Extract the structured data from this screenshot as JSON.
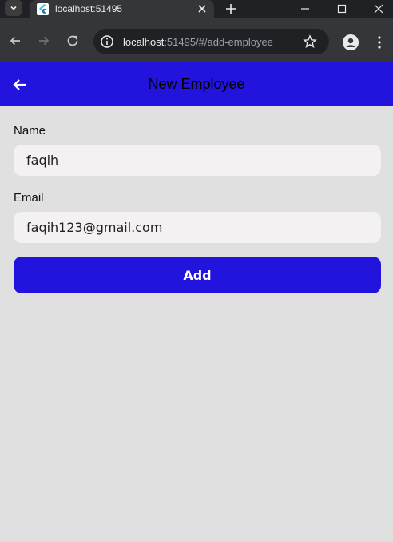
{
  "browser": {
    "tab_title": "localhost:51495",
    "url_host": "localhost",
    "url_rest": ":51495/#/add-employee"
  },
  "icons": {
    "tab_search": "chevron-down-icon",
    "favicon": "flutter-icon",
    "tab_close": "close-icon",
    "new_tab": "plus-icon",
    "minimize": "minimize-icon",
    "maximize": "maximize-icon",
    "window_close": "close-icon",
    "back": "arrow-left-icon",
    "forward": "arrow-right-icon",
    "reload": "reload-icon",
    "site_info": "info-icon",
    "bookmark": "star-icon",
    "profile": "person-icon",
    "menu": "more-vertical-icon",
    "appbar_back": "arrow-left-icon"
  },
  "app": {
    "title": "New Employee",
    "form": {
      "name_label": "Name",
      "name_value": "faqih",
      "email_label": "Email",
      "email_value": "faqih123@gmail.com",
      "add_label": "Add"
    }
  },
  "colors": {
    "primary": "#2214dc",
    "background": "#e0e0e0",
    "input_fill": "#f3f1f1"
  }
}
